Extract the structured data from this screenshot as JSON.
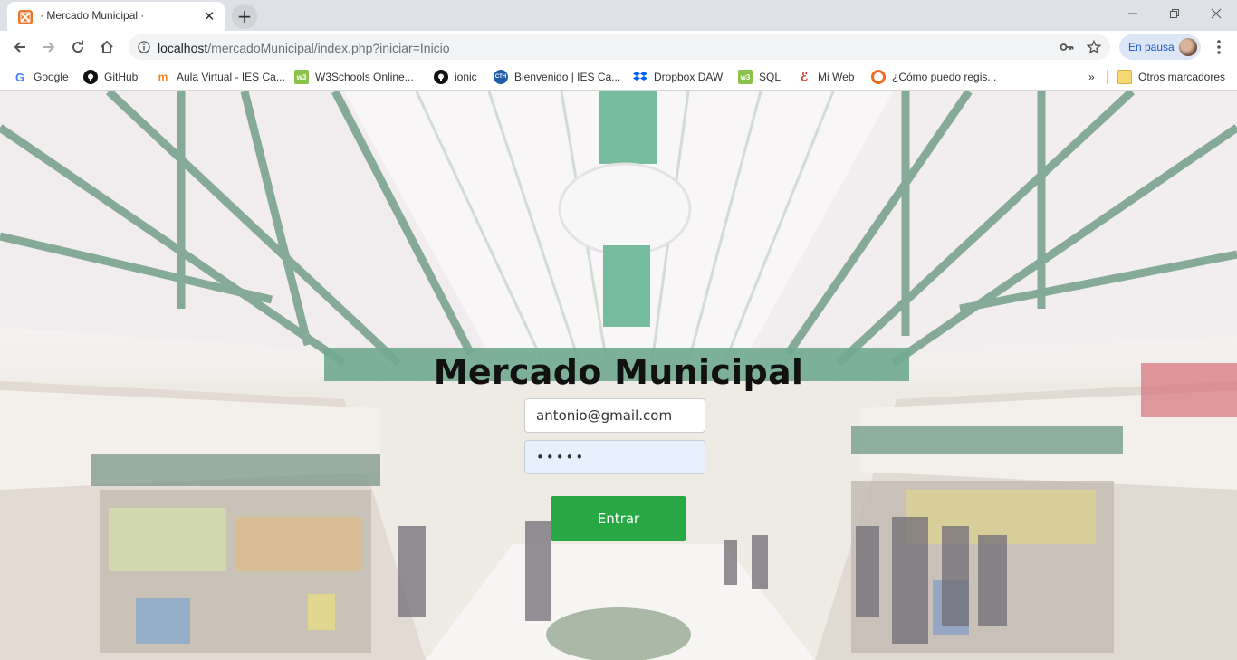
{
  "browser": {
    "tab": {
      "title": "· Mercado Municipal ·"
    },
    "url": {
      "host": "localhost",
      "path": "/mercadoMunicipal/index.php?iniciar=Inicio"
    },
    "profile": {
      "status_label": "En pausa"
    },
    "bookmarks": [
      {
        "label": "Google",
        "icon": "google-icon"
      },
      {
        "label": "GitHub",
        "icon": "github-icon"
      },
      {
        "label": "Aula Virtual - IES Ca...",
        "icon": "moodle-icon"
      },
      {
        "label": "W3Schools Online...",
        "icon": "w3schools-icon"
      },
      {
        "label": "ionic",
        "icon": "github-icon"
      },
      {
        "label": "Bienvenido | IES Ca...",
        "icon": "school-icon"
      },
      {
        "label": "Dropbox DAW",
        "icon": "dropbox-icon"
      },
      {
        "label": "SQL",
        "icon": "w3schools-icon"
      },
      {
        "label": "Mi Web",
        "icon": "web-icon"
      },
      {
        "label": "¿Cómo puedo regis...",
        "icon": "circle-icon"
      }
    ],
    "bookmarks_overflow": "»",
    "other_bookmarks": "Otros marcadores"
  },
  "page": {
    "title": "Mercado Municipal",
    "email_value": "antonio@gmail.com",
    "password_value": "•••••",
    "submit_label": "Entrar"
  },
  "colors": {
    "button": "#28a745",
    "autofill": "#e8f0fe",
    "accent_blue": "#1a56c6"
  }
}
